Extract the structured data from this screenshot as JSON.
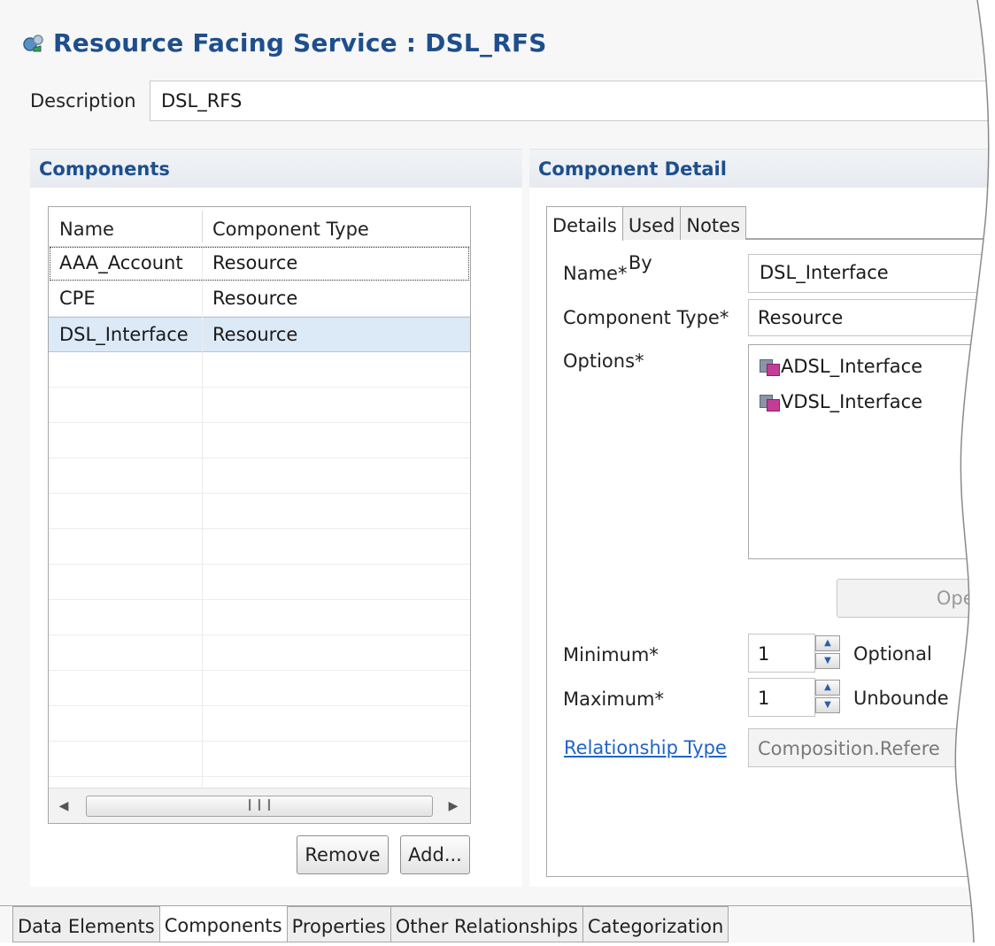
{
  "header": {
    "title": "Resource Facing Service : DSL_RFS",
    "description_label": "Description",
    "description_value": "DSL_RFS"
  },
  "components": {
    "section_title": "Components",
    "columns": [
      "Name",
      "Component Type"
    ],
    "rows": [
      {
        "name": "AAA_Account",
        "type": "Resource"
      },
      {
        "name": "CPE",
        "type": "Resource"
      },
      {
        "name": "DSL_Interface",
        "type": "Resource"
      }
    ],
    "remove_label": "Remove",
    "add_label": "Add..."
  },
  "detail": {
    "section_title": "Component Detail",
    "tabs": [
      "Details",
      "Used By",
      "Notes"
    ],
    "name_label": "Name*",
    "name_value": "DSL_Interface",
    "type_label": "Component Type*",
    "type_value": "Resource",
    "options_label": "Options*",
    "options": [
      "ADSL_Interface",
      "VDSL_Interface"
    ],
    "open_label": "Open",
    "minimum_label": "Minimum*",
    "minimum_value": "1",
    "optional_label": "Optional",
    "maximum_label": "Maximum*",
    "maximum_value": "1",
    "unbounded_label": "Unbounde",
    "relationship_label": "Relationship Type",
    "relationship_value": "Composition.Refere"
  },
  "bottom_tabs": [
    "Data Elements",
    "Components",
    "Properties",
    "Other Relationships",
    "Categorization"
  ],
  "colors": {
    "title": "#1e4f8c",
    "link": "#1f64c8",
    "selection": "#dce9f7"
  }
}
